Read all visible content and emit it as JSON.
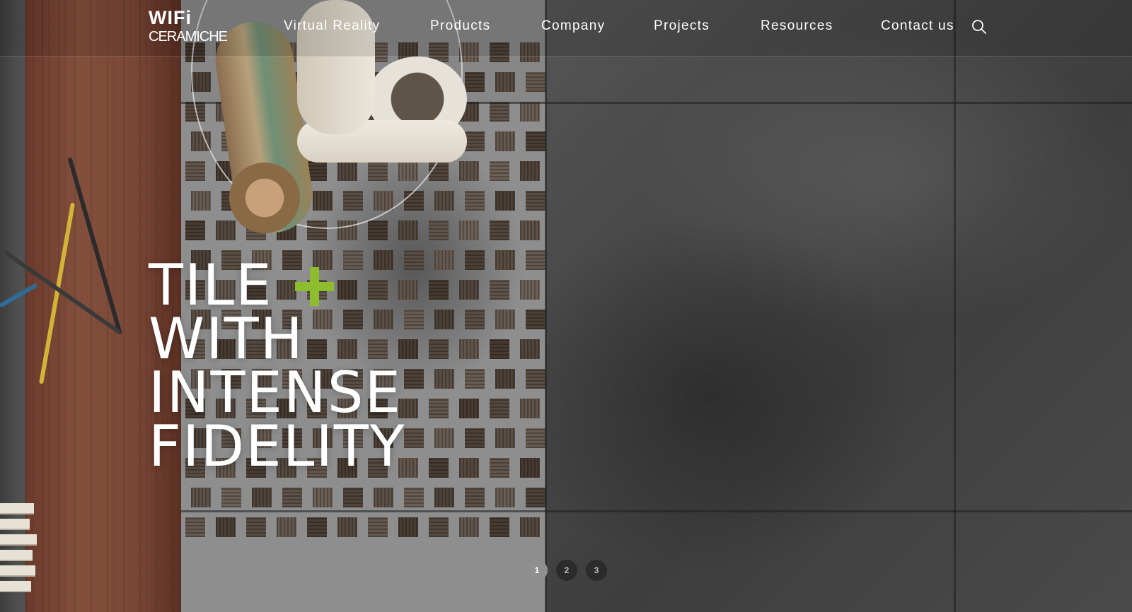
{
  "brand": {
    "logo_top": "WIFi",
    "logo_bottom": "CERAMICHE"
  },
  "nav": {
    "items": [
      {
        "label": "Virtual Reality"
      },
      {
        "label": "Products"
      },
      {
        "label": "Company"
      },
      {
        "label": "Projects"
      },
      {
        "label": "Resources"
      },
      {
        "label": "Contact us"
      }
    ],
    "search_icon": "search-icon"
  },
  "hero": {
    "lines": [
      "TILE",
      "WITH",
      "INTENSE",
      "FIDELITY"
    ],
    "accent_icon": "plus-icon"
  },
  "slider": {
    "pages": [
      "1",
      "2",
      "3"
    ],
    "active": "1"
  },
  "colors": {
    "accent": "#8dbd2f",
    "text": "#ffffff"
  }
}
